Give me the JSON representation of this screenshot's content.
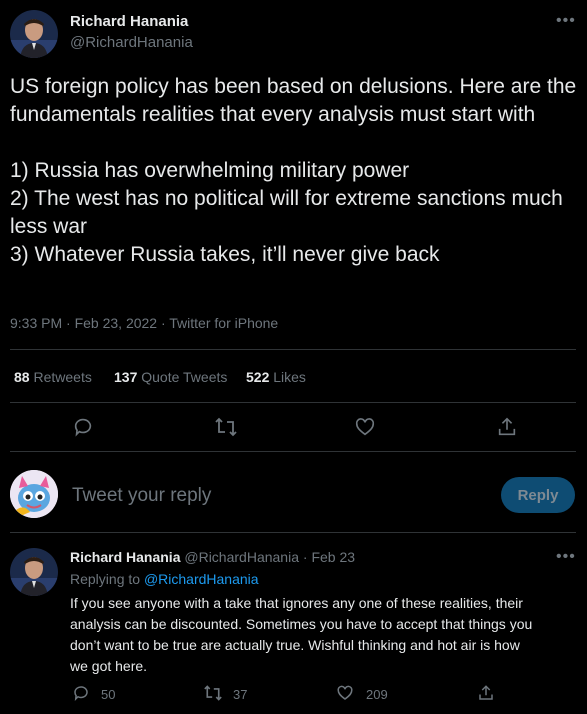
{
  "main_tweet": {
    "author_name": "Richard Hanania",
    "author_handle": "@RichardHanania",
    "text": "US foreign policy has been based on delusions. Here are the fundamentals realities that every analysis must start with\n\n1) Russia has overwhelming military power\n2) The west has no political will for extreme sanctions much less war\n3) Whatever Russia takes, it’ll never give back",
    "meta": "9:33 PM · Feb 23, 2022 · Twitter for iPhone",
    "stats": {
      "retweets_count": "88",
      "retweets_label": "Retweets",
      "quotes_count": "137",
      "quotes_label": "Quote Tweets",
      "likes_count": "522",
      "likes_label": "Likes"
    }
  },
  "composer": {
    "placeholder": "Tweet your reply",
    "button_label": "Reply"
  },
  "reply_tweet": {
    "author_name": "Richard Hanania",
    "author_handle": "@RichardHanania",
    "separator": "·",
    "date": "Feb 23",
    "replying_prefix": "Replying to",
    "replying_handle": "@RichardHanania",
    "text": "If you see anyone with a take that ignores any one of these realities, their\nanalysis can be discounted. Sometimes you have to accept that things you\ndon’t want to be true are actually true. Wishful thinking and hot air is how\nwe got here.",
    "reply_count": "50",
    "retweet_count": "37",
    "like_count": "209"
  },
  "icons": [
    "more-icon",
    "reply-icon",
    "retweet-icon",
    "like-icon",
    "share-icon"
  ],
  "colors": {
    "background": "#000000",
    "accent": "#1d9bf0",
    "reply_button": "#0e4c73"
  }
}
